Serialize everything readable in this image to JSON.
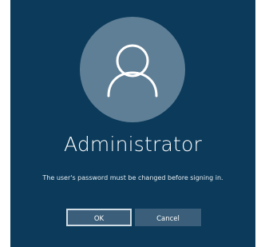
{
  "login": {
    "username": "Administrator",
    "message": "The user's password must be changed before signing in.",
    "ok_label": "OK",
    "cancel_label": "Cancel"
  },
  "icons": {
    "avatar": "user-silhouette-icon"
  },
  "colors": {
    "background": "#0b3a5a",
    "avatar_circle": "#5f7f96",
    "button_fill": "#3b5f7a",
    "focused_border": "#cfdbe4",
    "text": "#ffffff"
  }
}
